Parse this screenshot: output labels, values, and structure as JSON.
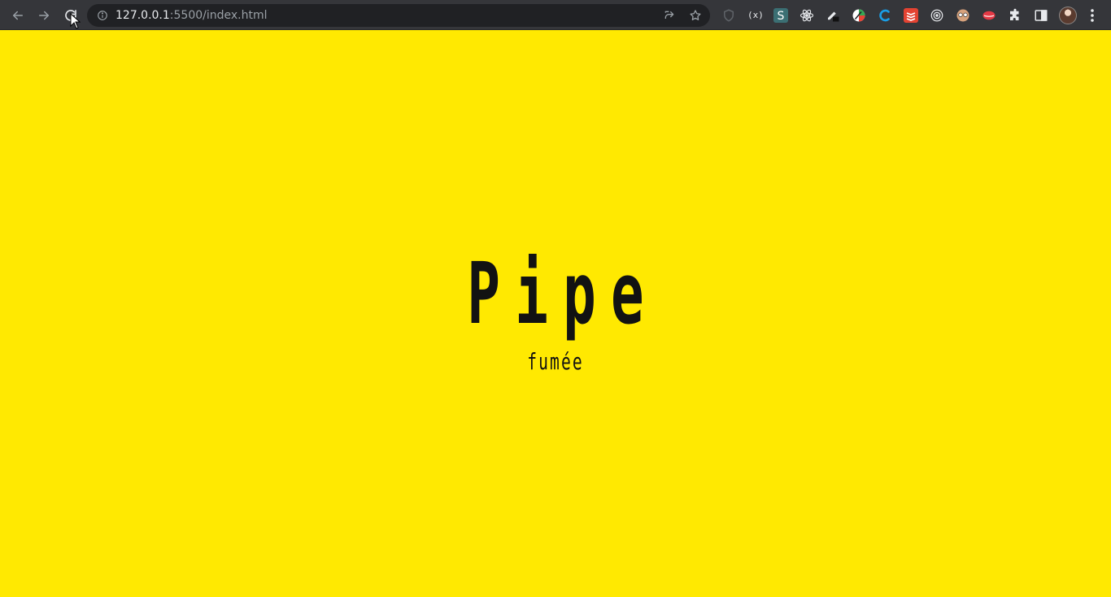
{
  "browser": {
    "url_host": "127.0.0.1",
    "url_rest": ":5500/index.html",
    "nav": {
      "back_icon": "back-arrow-icon",
      "forward_icon": "forward-arrow-icon",
      "reload_icon": "reload-icon"
    },
    "extensions": [
      {
        "name": "extension-shield",
        "color": "#2b2c2f"
      },
      {
        "name": "extension-code",
        "label": "(x)",
        "color": "#35363a"
      },
      {
        "name": "extension-s",
        "label": "S",
        "color": "#3b6f73"
      },
      {
        "name": "extension-react",
        "color": "#35363a"
      },
      {
        "name": "extension-pen",
        "color": "#35363a"
      },
      {
        "name": "extension-colorful",
        "color": "#35363a"
      },
      {
        "name": "extension-c",
        "color": "#35363a"
      },
      {
        "name": "extension-todo",
        "color": "#e44332"
      },
      {
        "name": "extension-target",
        "color": "#35363a"
      },
      {
        "name": "extension-glasses",
        "color": "#35363a"
      },
      {
        "name": "extension-lips",
        "color": "#35363a"
      },
      {
        "name": "extension-puzzle",
        "color": "#35363a"
      },
      {
        "name": "extension-sidepanel",
        "color": "#35363a"
      }
    ],
    "colors": {
      "toolbar": "#35363a",
      "omnibox": "#202124",
      "text": "#e8eaed",
      "muted": "#9aa0a6"
    }
  },
  "page": {
    "background": "#ffe901",
    "title": "Pipe",
    "subtitle": "fumée",
    "text_color": "#121212"
  }
}
